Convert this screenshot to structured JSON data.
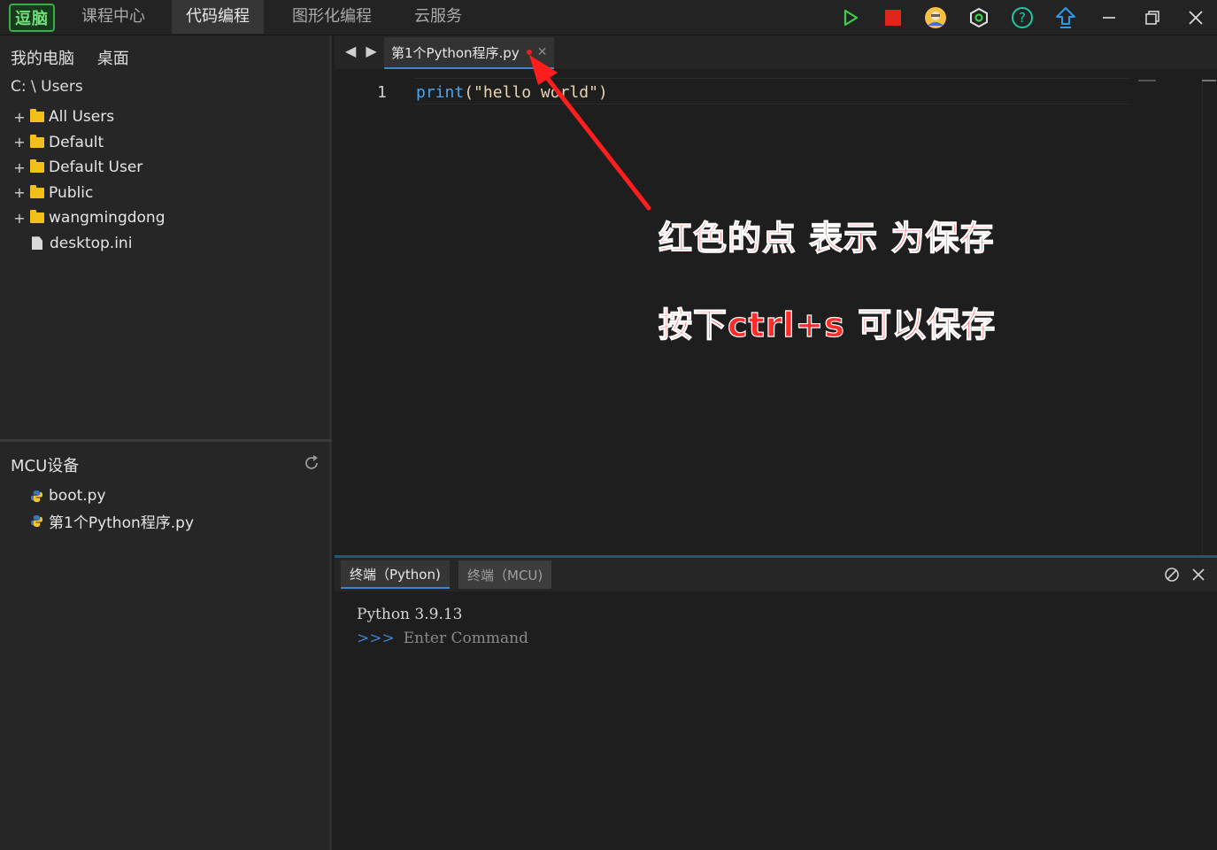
{
  "app": {
    "logo_text": "逗脑"
  },
  "nav": {
    "tabs": [
      {
        "label": "课程中心"
      },
      {
        "label": "代码编程"
      },
      {
        "label": "图形化编程"
      },
      {
        "label": "云服务"
      }
    ],
    "active": "代码编程"
  },
  "toolbar": {
    "icons": [
      "play-icon",
      "stop-icon",
      "user-avatar-icon",
      "settings-hex-icon",
      "help-icon",
      "upload-icon",
      "minimize-icon",
      "restore-icon",
      "close-icon"
    ]
  },
  "sidebar": {
    "tabs": [
      "我的电脑",
      "桌面"
    ],
    "breadcrumb": "C: \\ Users",
    "tree": [
      {
        "type": "folder",
        "label": "All Users"
      },
      {
        "type": "folder",
        "label": "Default"
      },
      {
        "type": "folder",
        "label": "Default User"
      },
      {
        "type": "folder",
        "label": "Public"
      },
      {
        "type": "folder",
        "label": "wangmingdong"
      },
      {
        "type": "file",
        "label": "desktop.ini"
      }
    ],
    "mcu_title": "MCU设备",
    "mcu_files": [
      "boot.py",
      "第1个Python程序.py"
    ]
  },
  "editor": {
    "tab_label": "第1个Python程序.py",
    "unsaved": true,
    "line_number": "1",
    "code_func": "print",
    "code_open": "(",
    "code_str": "\"hello world\"",
    "code_close": ")"
  },
  "annotation": {
    "line1": "红色的点 表示 为保存",
    "line2": "按下ctrl+s 可以保存",
    "color": "#ff2a2a"
  },
  "terminal": {
    "tabs": [
      "终端（Python)",
      "终端（MCU)"
    ],
    "line1": "Python 3.9.13",
    "prompt": ">>>",
    "placeholder": "Enter Command"
  }
}
